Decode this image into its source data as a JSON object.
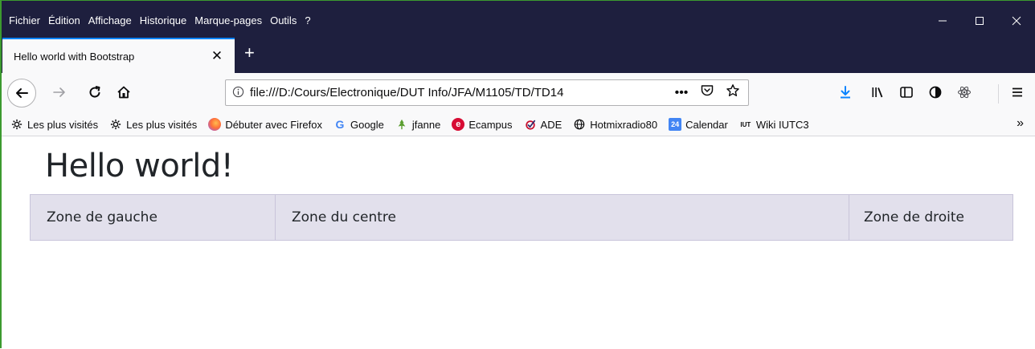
{
  "menu": {
    "items": [
      {
        "label": "Fichier"
      },
      {
        "label": "Édition"
      },
      {
        "label": "Affichage"
      },
      {
        "label": "Historique"
      },
      {
        "label": "Marque-pages"
      },
      {
        "label": "Outils"
      },
      {
        "label": "?"
      }
    ]
  },
  "window_controls": {
    "minimize": "—",
    "maximize": "☐",
    "close": "✕"
  },
  "tab": {
    "title": "Hello world with Bootstrap",
    "close": "✕",
    "new_tab": "+"
  },
  "navbar": {
    "url": "file:///D:/Cours/Electronique/DUT Info/JFA/M1105/TD/TD14",
    "page_actions": "•••"
  },
  "bookmarks": {
    "items": [
      {
        "label": "Les plus visités",
        "icon": "gear-icon"
      },
      {
        "label": "Les plus visités",
        "icon": "gear-icon"
      },
      {
        "label": "Débuter avec Firefox",
        "icon": "firefox-icon"
      },
      {
        "label": "Google",
        "icon": "google-icon"
      },
      {
        "label": "jfanne",
        "icon": "leaf-icon"
      },
      {
        "label": "Ecampus",
        "icon": "ecampus-icon"
      },
      {
        "label": "ADE",
        "icon": "ade-icon"
      },
      {
        "label": "Hotmixradio80",
        "icon": "globe-icon"
      },
      {
        "label": "Calendar",
        "icon": "calendar-icon",
        "badge": "24"
      },
      {
        "label": "Wiki IUTC3",
        "icon": "iut-icon",
        "badge": "IUT"
      }
    ],
    "more": "»"
  },
  "page": {
    "heading": "Hello world!",
    "zones": {
      "left": "Zone de gauche",
      "center": "Zone du centre",
      "right": "Zone de droite"
    }
  },
  "colors": {
    "titlebar": "#1e1f3e",
    "accent_tab": "#0a84ff",
    "zone_bg": "#e2e0ec",
    "download_arrow": "#0a84ff"
  }
}
